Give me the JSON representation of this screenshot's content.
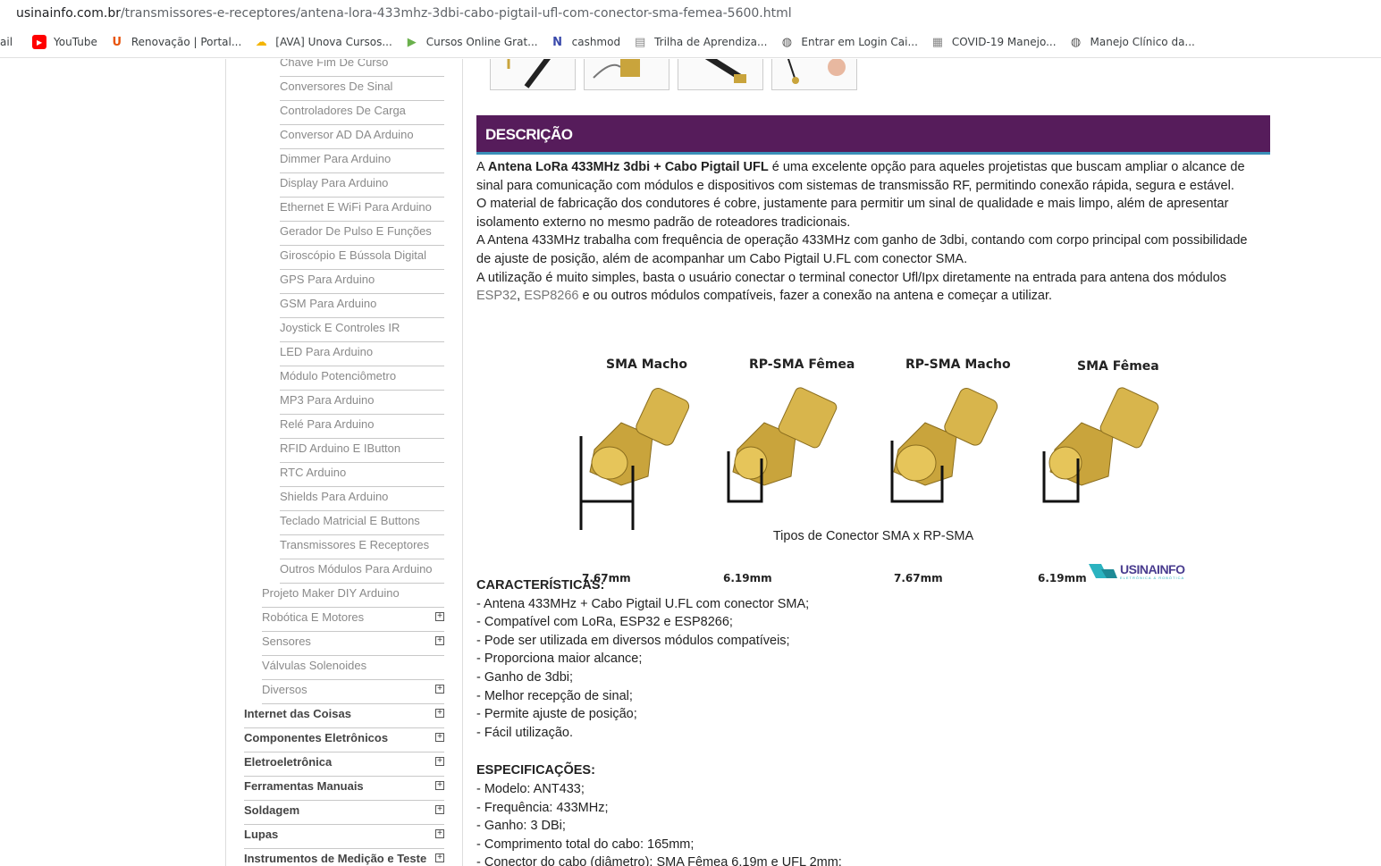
{
  "browser": {
    "url_host": "usinainfo.com.br",
    "url_path": "/transmissores-e-receptores/antena-lora-433mhz-3dbi-cabo-pigtail-ufl-com-conector-sma-femea-5600.html",
    "bookmarks": [
      {
        "label": "ail",
        "icon": "none"
      },
      {
        "label": "YouTube",
        "icon": "youtube-icon"
      },
      {
        "label": "Renovação | Portal...",
        "icon": "u-logo-icon"
      },
      {
        "label": "[AVA] Unova Cursos...",
        "icon": "cloud-icon"
      },
      {
        "label": "Cursos Online Grat...",
        "icon": "play-icon"
      },
      {
        "label": "cashmod",
        "icon": "n-logo-icon"
      },
      {
        "label": "Trilha de Aprendiza...",
        "icon": "page-icon"
      },
      {
        "label": "Entrar em Login Cai...",
        "icon": "globe-icon"
      },
      {
        "label": "COVID-19 Manejo...",
        "icon": "calendar-icon"
      },
      {
        "label": "Manejo Clínico da...",
        "icon": "globe-icon"
      }
    ]
  },
  "sidebar": {
    "items": [
      {
        "label": "Chave Fim De Curso",
        "level": 3,
        "expand": false
      },
      {
        "label": "Conversores De Sinal",
        "level": 3,
        "expand": false
      },
      {
        "label": "Controladores De Carga",
        "level": 3,
        "expand": false
      },
      {
        "label": "Conversor AD DA Arduino",
        "level": 3,
        "expand": false
      },
      {
        "label": "Dimmer Para Arduino",
        "level": 3,
        "expand": false
      },
      {
        "label": "Display Para Arduino",
        "level": 3,
        "expand": false
      },
      {
        "label": "Ethernet E WiFi Para Arduino",
        "level": 3,
        "expand": false
      },
      {
        "label": "Gerador De Pulso E Funções",
        "level": 3,
        "expand": false
      },
      {
        "label": "Giroscópio E Bússola Digital",
        "level": 3,
        "expand": false
      },
      {
        "label": "GPS Para Arduino",
        "level": 3,
        "expand": false
      },
      {
        "label": "GSM Para Arduino",
        "level": 3,
        "expand": false
      },
      {
        "label": "Joystick E Controles IR",
        "level": 3,
        "expand": false
      },
      {
        "label": "LED Para Arduino",
        "level": 3,
        "expand": false
      },
      {
        "label": "Módulo Potenciômetro",
        "level": 3,
        "expand": false
      },
      {
        "label": "MP3 Para Arduino",
        "level": 3,
        "expand": false
      },
      {
        "label": "Relé Para Arduino",
        "level": 3,
        "expand": false
      },
      {
        "label": "RFID Arduino E IButton",
        "level": 3,
        "expand": false
      },
      {
        "label": "RTC Arduino",
        "level": 3,
        "expand": false
      },
      {
        "label": "Shields Para Arduino",
        "level": 3,
        "expand": false
      },
      {
        "label": "Teclado Matricial E Buttons",
        "level": 3,
        "expand": false
      },
      {
        "label": "Transmissores E Receptores",
        "level": 3,
        "expand": false
      },
      {
        "label": "Outros Módulos Para Arduino",
        "level": 3,
        "expand": false
      },
      {
        "label": "Projeto Maker DIY Arduino",
        "level": 2,
        "expand": false
      },
      {
        "label": "Robótica E Motores",
        "level": 2,
        "expand": true
      },
      {
        "label": "Sensores",
        "level": 2,
        "expand": true
      },
      {
        "label": "Válvulas Solenoides",
        "level": 2,
        "expand": false
      },
      {
        "label": "Diversos",
        "level": 2,
        "expand": true
      },
      {
        "label": "Internet das Coisas",
        "level": 1,
        "expand": true
      },
      {
        "label": "Componentes Eletrônicos",
        "level": 1,
        "expand": true
      },
      {
        "label": "Eletroeletrônica",
        "level": 1,
        "expand": true
      },
      {
        "label": "Ferramentas Manuais",
        "level": 1,
        "expand": true
      },
      {
        "label": "Soldagem",
        "level": 1,
        "expand": true
      },
      {
        "label": "Lupas",
        "level": 1,
        "expand": true
      },
      {
        "label": "Instrumentos de Medição e Teste",
        "level": 1,
        "expand": true
      }
    ],
    "expand_symbol": "+"
  },
  "description": {
    "header": "DESCRIÇÃO",
    "p1_prefix": "A ",
    "p1_bold": "Antena LoRa 433MHz 3dbi + Cabo Pigtail UFL",
    "p1_rest": " é uma excelente opção para aqueles projetistas que buscam ampliar o alcance de sinal para comunicação com módulos e dispositivos com sistemas de transmissão RF, permitindo conexão rápida, segura e estável.",
    "p2": "O material de fabricação dos condutores é cobre, justamente para permitir um sinal de qualidade e mais limpo, além de apresentar isolamento externo no mesmo padrão de roteadores tradicionais.",
    "p3": "A Antena 433MHz trabalha com frequência de operação 433MHz com ganho de 3dbi, contando com corpo principal com possibilidade de ajuste de posição, além de acompanhar um Cabo Pigtail U.FL com conector SMA.",
    "p4_prefix": "A utilização é muito simples, basta o usuário conectar o terminal conector Ufl/Ipx diretamente na entrada para antena dos módulos ",
    "p4_link1": "ESP32",
    "p4_sep": ", ",
    "p4_link2": "ESP8266",
    "p4_rest": " e ou outros módulos compatíveis, fazer a conexão na antena e começar a utilizar."
  },
  "figure": {
    "labels": [
      "SMA Macho",
      "RP-SMA Fêmea",
      "RP-SMA Macho",
      "SMA Fêmea"
    ],
    "measures": [
      "7.67mm",
      "6.19mm",
      "7.67mm",
      "6.19mm"
    ],
    "logo": "USINAINFO",
    "logo_sub": "ELETRÔNICA & ROBÓTICA",
    "caption": "Tipos de Conector SMA x RP-SMA",
    "gold_color": "#c9a43c"
  },
  "features": {
    "title": "CARACTERÍSTICAS:",
    "items": [
      "- Antena 433MHz + Cabo Pigtail U.FL com conector SMA;",
      "- Compatível com LoRa, ESP32 e ESP8266;",
      "- Pode ser utilizada em diversos módulos compatíveis;",
      "- Proporciona maior alcance;",
      "- Ganho de 3dbi;",
      "- Melhor recepção de sinal;",
      "- Permite ajuste de posição;",
      "- Fácil utilização."
    ]
  },
  "specs": {
    "title": "ESPECIFICAÇÕES:",
    "items": [
      "- Modelo: ANT433;",
      "- Frequência: 433MHz;",
      "- Ganho: 3 DBi;",
      "- Comprimento total do cabo: 165mm;",
      "- Conector do cabo (diâmetro): SMA Fêmea 6,19m e UFL 2mm;"
    ]
  },
  "colors": {
    "header_bg": "#561c5b",
    "header_accent": "#3a8fb8",
    "youtube": "#ff0000",
    "u_logo": "#e8540c"
  }
}
